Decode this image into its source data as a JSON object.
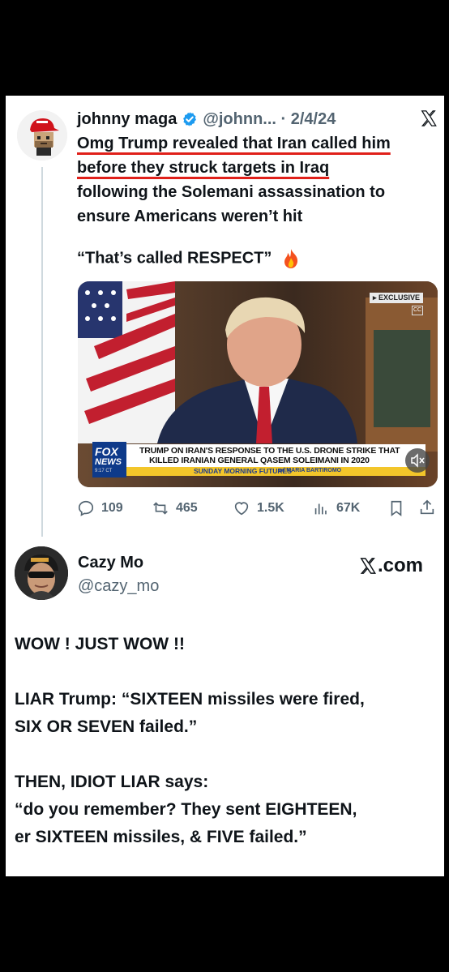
{
  "tweet1": {
    "display_name": "johnny maga",
    "handle_date": "@johnn... · 2/4/24",
    "text_lines_underlined": [
      "Omg Trump revealed that Iran called him",
      "before they struck targets in Iraq"
    ],
    "text_lines": [
      "following the Solemani assassination to",
      "ensure Americans weren’t hit"
    ],
    "quote": "“That’s called RESPECT”",
    "media": {
      "badge": "▸ EXCLUSIVE",
      "cc": "CC",
      "network_line1": "FOX",
      "network_line2": "NEWS",
      "network_time": "9:17 CT",
      "chyron_line1": "TRUMP ON IRAN'S RESPONSE TO THE U.S. DRONE STRIKE THAT",
      "chyron_line2": "KILLED IRANIAN GENERAL QASEM SOLEIMANI IN 2020",
      "show": "SUNDAY MORNING FUTURES",
      "host": "w/ MARIA BARTIROMO"
    },
    "stats": {
      "replies": "109",
      "reposts": "465",
      "likes": "1.5K",
      "views": "67K"
    },
    "colors": {
      "underline": "#e0201a",
      "verified": "#1d9bf0",
      "chyron": "#f3c62a"
    }
  },
  "tweet2": {
    "display_name": "Cazy Mo",
    "handle": "@cazy_mo",
    "brand": ".com",
    "paragraphs": [
      [
        "WOW !  JUST WOW !!"
      ],
      [
        "LIAR Trump: “SIXTEEN missiles were fired,",
        "SIX OR SEVEN failed.”"
      ],
      [
        "THEN, IDIOT LIAR says:",
        "“do you remember? They sent EIGHTEEN,",
        "er SIXTEEN missiles, & FIVE failed.”"
      ]
    ]
  }
}
